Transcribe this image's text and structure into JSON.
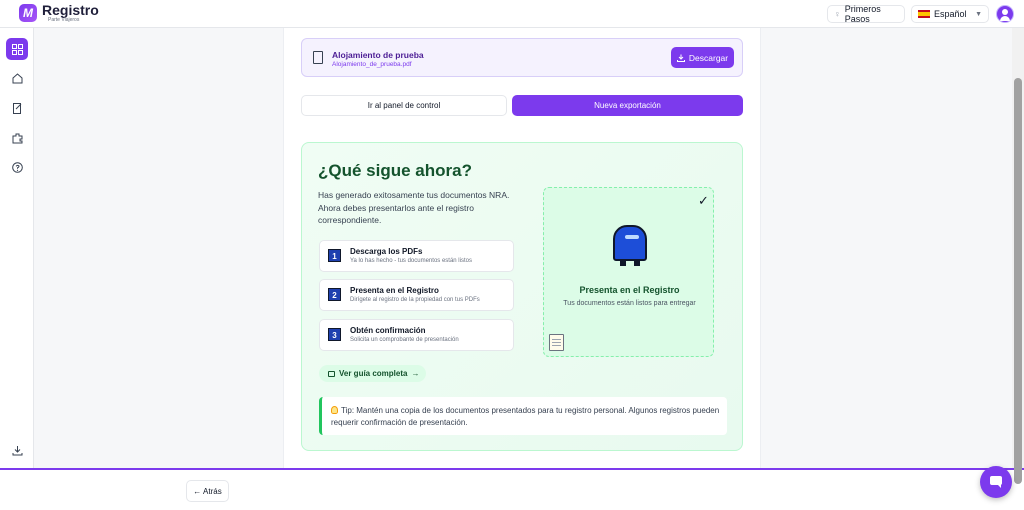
{
  "header": {
    "brand_name": "Registro",
    "brand_sub": "Parte Viajeros",
    "logo_letter": "M",
    "guide_label": "Primeros Pasos",
    "language_label": "Español",
    "accent": "#7c3aed"
  },
  "sidebar": {
    "items": [
      {
        "icon": "dashboard-grid-icon",
        "active": true
      },
      {
        "icon": "home-icon"
      },
      {
        "icon": "document-edit-icon"
      },
      {
        "icon": "puzzle-icon"
      },
      {
        "icon": "help-icon"
      },
      {
        "icon": "download-icon"
      }
    ]
  },
  "download_card": {
    "name": "Alojamiento de prueba",
    "file": "Alojamiento_de_prueba.pdf",
    "button": "Descargar"
  },
  "actions": {
    "panel": "Ir al panel de control",
    "new_export": "Nueva exportación"
  },
  "next_steps": {
    "title": "¿Qué sigue ahora?",
    "description": "Has generado exitosamente tus documentos NRA. Ahora debes presentarlos ante el registro correspondiente.",
    "steps": [
      {
        "num": "1",
        "title": "Descarga los PDFs",
        "subtitle": "Ya lo has hecho - tus documentos están listos"
      },
      {
        "num": "2",
        "title": "Presenta en el Registro",
        "subtitle": "Dirígete al registro de la propiedad con tus PDFs"
      },
      {
        "num": "3",
        "title": "Obtén confirmación",
        "subtitle": "Solicita un comprobante de presentación"
      }
    ],
    "guide_link": "Ver guía completa",
    "guide_arrow": "→",
    "registry_panel": {
      "check": "✓",
      "title": "Presenta en el Registro",
      "subtitle": "Tus documentos están listos para entregar"
    },
    "tip": "Tip: Mantén una copia de los documentos presentados para tu registro personal. Algunos registros pueden requerir confirmación de presentación."
  },
  "footer": {
    "back_label": "← Atrás"
  }
}
